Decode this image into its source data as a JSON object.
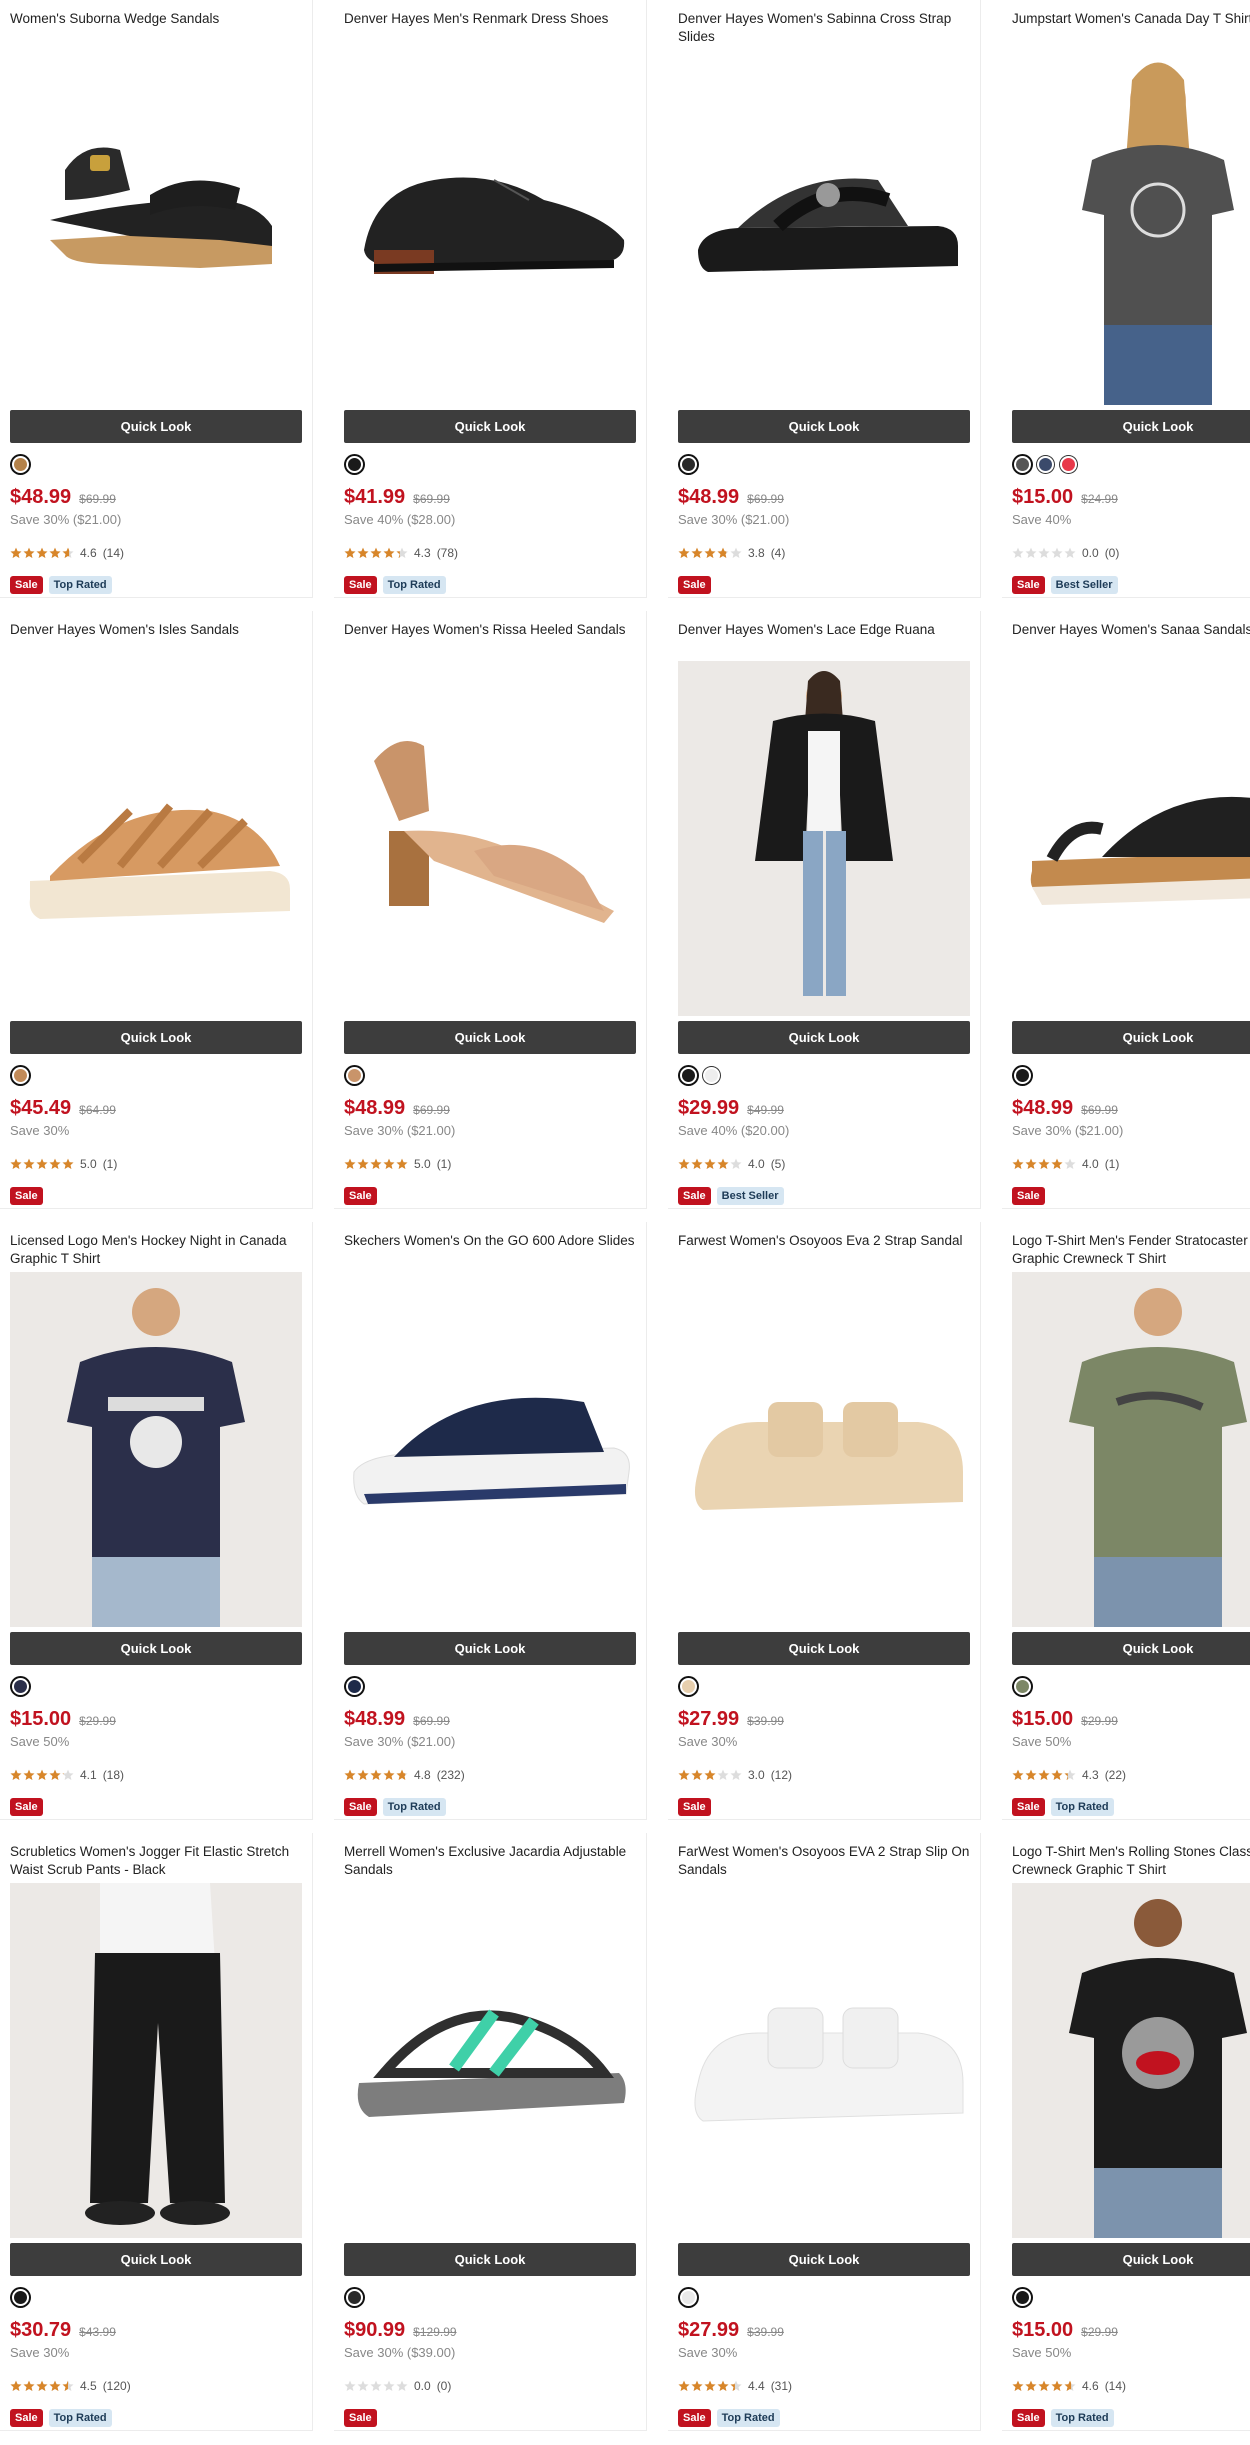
{
  "quick_look_label": "Quick Look",
  "products": [
    {
      "title": "Women's Suborna Wedge Sandals",
      "image": "wedge-sandal",
      "swatches": [
        "#b4824a"
      ],
      "price": "$48.99",
      "was": "$69.99",
      "save": "Save 30% ($21.00)",
      "rating": 4.6,
      "rating_text": "4.6",
      "reviews": "(14)",
      "badges": [
        "Sale",
        "Top Rated"
      ]
    },
    {
      "title": "Denver Hayes Men's Renmark Dress Shoes",
      "image": "dress-shoe",
      "swatches": [
        "#1a1a1a"
      ],
      "price": "$41.99",
      "was": "$69.99",
      "save": "Save 40% ($28.00)",
      "rating": 4.3,
      "rating_text": "4.3",
      "reviews": "(78)",
      "badges": [
        "Sale",
        "Top Rated"
      ]
    },
    {
      "title": "Denver Hayes Women's Sabinna Cross Strap Slides",
      "image": "cross-slide",
      "swatches": [
        "#2a2a2a"
      ],
      "price": "$48.99",
      "was": "$69.99",
      "save": "Save 30% ($21.00)",
      "rating": 3.8,
      "rating_text": "3.8",
      "reviews": "(4)",
      "badges": [
        "Sale"
      ]
    },
    {
      "title": "Jumpstart Women's Canada Day T Shirt",
      "image": "womens-tshirt",
      "swatches": [
        "#555555",
        "#3b4a6b",
        "#e8394a"
      ],
      "price": "$15.00",
      "was": "$24.99",
      "save": "Save 40%",
      "rating": 0,
      "rating_text": "0.0",
      "reviews": "(0)",
      "badges": [
        "Sale",
        "Best Seller"
      ]
    },
    {
      "title": "Denver Hayes Women's Isles Sandals",
      "image": "strappy-sandal",
      "swatches": [
        "#c18a58"
      ],
      "price": "$45.49",
      "was": "$64.99",
      "save": "Save 30%",
      "rating": 5.0,
      "rating_text": "5.0",
      "reviews": "(1)",
      "badges": [
        "Sale"
      ]
    },
    {
      "title": "Denver Hayes Women's Rissa Heeled Sandals",
      "image": "heeled-sandal",
      "swatches": [
        "#c9946a"
      ],
      "price": "$48.99",
      "was": "$69.99",
      "save": "Save 30% ($21.00)",
      "rating": 5.0,
      "rating_text": "5.0",
      "reviews": "(1)",
      "badges": [
        "Sale"
      ]
    },
    {
      "title": "Denver Hayes Women's Lace Edge Ruana",
      "image": "ruana",
      "swatches": [
        "#1a1a1a",
        "#eeeeee"
      ],
      "price": "$29.99",
      "was": "$49.99",
      "save": "Save 40% ($20.00)",
      "rating": 4.0,
      "rating_text": "4.0",
      "reviews": "(5)",
      "badges": [
        "Sale",
        "Best Seller"
      ]
    },
    {
      "title": "Denver Hayes Women's Sanaa Sandals",
      "image": "sanaa-sandal",
      "swatches": [
        "#1a1a1a"
      ],
      "price": "$48.99",
      "was": "$69.99",
      "save": "Save 30% ($21.00)",
      "rating": 4.0,
      "rating_text": "4.0",
      "reviews": "(1)",
      "badges": [
        "Sale"
      ]
    },
    {
      "title": "Licensed Logo Men's Hockey Night in Canada Graphic T Shirt",
      "image": "hockey-tshirt",
      "swatches": [
        "#2b2f4a"
      ],
      "price": "$15.00",
      "was": "$29.99",
      "save": "Save 50%",
      "rating": 4.1,
      "rating_text": "4.1",
      "reviews": "(18)",
      "badges": [
        "Sale"
      ]
    },
    {
      "title": "Skechers Women's On the GO 600 Adore Slides",
      "image": "skechers-slide",
      "swatches": [
        "#1e2a4a"
      ],
      "price": "$48.99",
      "was": "$69.99",
      "save": "Save 30% ($21.00)",
      "rating": 4.8,
      "rating_text": "4.8",
      "reviews": "(232)",
      "badges": [
        "Sale",
        "Top Rated"
      ]
    },
    {
      "title": "Farwest Women's Osoyoos Eva 2 Strap Sandal",
      "image": "eva-sandal-tan",
      "swatches": [
        "#e7cfae"
      ],
      "price": "$27.99",
      "was": "$39.99",
      "save": "Save 30%",
      "rating": 3.0,
      "rating_text": "3.0",
      "reviews": "(12)",
      "badges": [
        "Sale"
      ]
    },
    {
      "title": "Logo T-Shirt Men's Fender Stratocaster Vintage Graphic Crewneck T Shirt",
      "image": "fender-tshirt",
      "swatches": [
        "#7c8766"
      ],
      "price": "$15.00",
      "was": "$29.99",
      "save": "Save 50%",
      "rating": 4.3,
      "rating_text": "4.3",
      "reviews": "(22)",
      "badges": [
        "Sale",
        "Top Rated"
      ]
    },
    {
      "title": "Scrubletics Women's Jogger Fit Elastic Stretch Waist Scrub Pants - Black",
      "image": "scrub-pants",
      "swatches": [
        "#1a1a1a"
      ],
      "price": "$30.79",
      "was": "$43.99",
      "save": "Save 30%",
      "rating": 4.5,
      "rating_text": "4.5",
      "reviews": "(120)",
      "badges": [
        "Sale",
        "Top Rated"
      ]
    },
    {
      "title": "Merrell Women's Exclusive Jacardia Adjustable Sandals",
      "image": "merrell-sandal",
      "swatches": [
        "#2a2a2a"
      ],
      "price": "$90.99",
      "was": "$129.99",
      "save": "Save 30% ($39.00)",
      "rating": 0,
      "rating_text": "0.0",
      "reviews": "(0)",
      "badges": [
        "Sale"
      ]
    },
    {
      "title": "FarWest Women's Osoyoos EVA 2 Strap Slip On Sandals",
      "image": "eva-sandal-white",
      "swatches": [
        "#e9e9e9"
      ],
      "price": "$27.99",
      "was": "$39.99",
      "save": "Save 30%",
      "rating": 4.4,
      "rating_text": "4.4",
      "reviews": "(31)",
      "badges": [
        "Sale",
        "Top Rated"
      ]
    },
    {
      "title": "Logo T-Shirt Men's Rolling Stones Classic Logo Crewneck Graphic T Shirt",
      "image": "stones-tshirt",
      "swatches": [
        "#1a1a1a"
      ],
      "price": "$15.00",
      "was": "$29.99",
      "save": "Save 50%",
      "rating": 4.6,
      "rating_text": "4.6",
      "reviews": "(14)",
      "badges": [
        "Sale",
        "Top Rated"
      ]
    }
  ]
}
